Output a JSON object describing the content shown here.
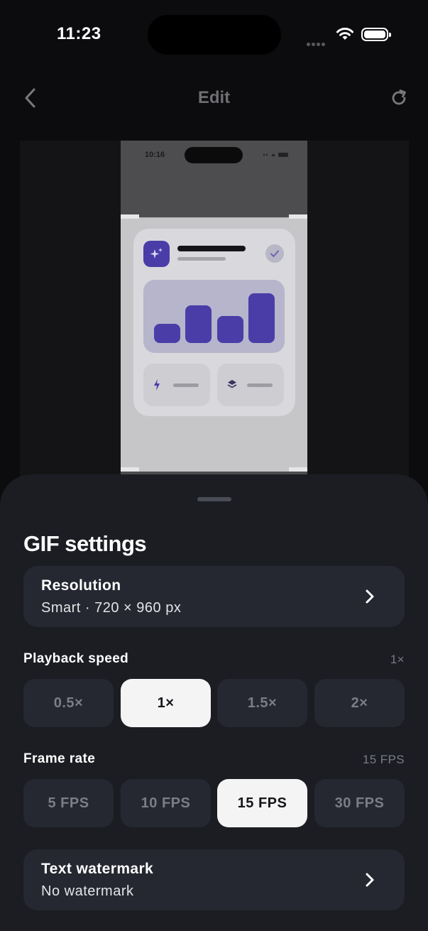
{
  "status_bar": {
    "time": "11:23"
  },
  "nav": {
    "title": "Edit"
  },
  "preview": {
    "phone_time": "10:16"
  },
  "sheet": {
    "title": "GIF settings",
    "resolution": {
      "label": "Resolution",
      "value": "Smart · 720 × 960 px"
    },
    "playback_speed": {
      "label": "Playback speed",
      "current": "1×",
      "options": [
        "0.5×",
        "1×",
        "1.5×",
        "2×"
      ],
      "selected_index": 1
    },
    "frame_rate": {
      "label": "Frame rate",
      "current": "15 FPS",
      "options": [
        "5 FPS",
        "10 FPS",
        "15 FPS",
        "30 FPS"
      ],
      "selected_index": 2
    },
    "watermark": {
      "label": "Text watermark",
      "value": "No watermark"
    }
  },
  "colors": {
    "accent": "#4a3da8",
    "sheet_bg": "#1b1d23",
    "card_bg": "#252831",
    "selected": "#f4f4f5"
  },
  "icons": [
    "back-chevron-icon",
    "reset-icon",
    "wifi-icon",
    "battery-icon",
    "sparkle-icon",
    "check-icon",
    "bolt-icon",
    "layers-icon",
    "chevron-right-icon"
  ]
}
